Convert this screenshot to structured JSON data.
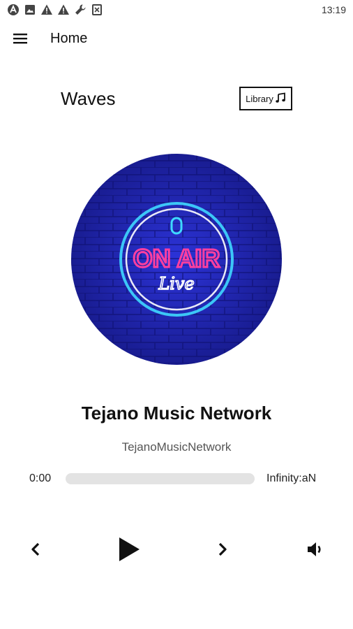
{
  "status_bar": {
    "time": "13:19",
    "icons": [
      "system-icon",
      "image-icon",
      "warning-icon",
      "warning-icon",
      "wrench-icon",
      "notification-icon"
    ]
  },
  "app_bar": {
    "title": "Home",
    "menu_icon": "hamburger-menu-icon"
  },
  "header": {
    "title": "Waves",
    "library_label": "Library",
    "library_icon": "music-note-icon"
  },
  "artwork": {
    "sign_text": "ON AIR",
    "sign_subtext": "Live",
    "colors": {
      "background": "#1f22a8",
      "neon_pink": "#ff3fa0",
      "neon_blue": "#3fd8ff"
    }
  },
  "track": {
    "title": "Tejano Music Network",
    "subtitle": "TejanoMusicNetwork"
  },
  "playback": {
    "current_time": "0:00",
    "total_time": "Infinity:aN",
    "progress": 0
  },
  "controls": {
    "icons": [
      "previous-icon",
      "play-icon",
      "next-icon",
      "volume-icon"
    ]
  }
}
